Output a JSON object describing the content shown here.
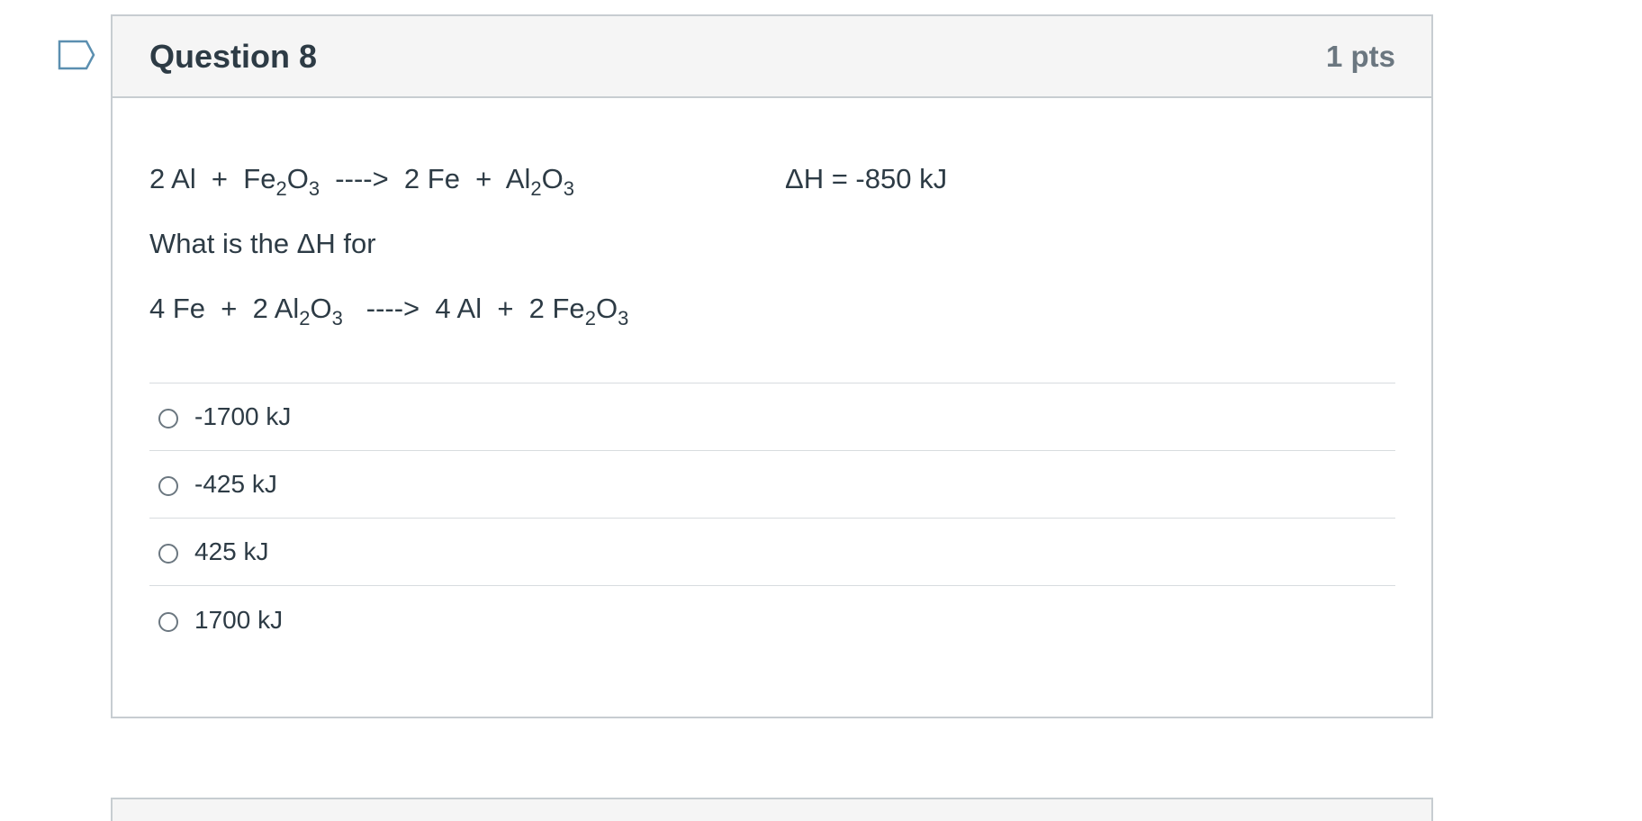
{
  "question": {
    "title": "Question 8",
    "points": "1 pts",
    "reaction1": {
      "parts": [
        "2 Al  +  Fe",
        "2",
        "O",
        "3",
        "  ---->  2 Fe  +  Al",
        "2",
        "O",
        "3"
      ],
      "delta_h": "ΔH = -850 kJ"
    },
    "prompt": "What is the ΔH for",
    "reaction2": {
      "parts": [
        "4 Fe  +  2 Al",
        "2",
        "O",
        "3",
        "   ---->  4 Al  +  2 Fe",
        "2",
        "O",
        "3"
      ]
    },
    "answers": [
      {
        "label": "-1700 kJ"
      },
      {
        "label": "-425 kJ"
      },
      {
        "label": "425 kJ"
      },
      {
        "label": "1700 kJ"
      }
    ]
  },
  "colors": {
    "flag_outline": "#5b8fb0",
    "border": "#c7cdd1",
    "header_bg": "#f5f5f5",
    "text": "#2d3b45",
    "muted": "#6b7780"
  },
  "icons": {
    "flag": "flag-icon",
    "radio": "radio-unchecked-icon"
  }
}
